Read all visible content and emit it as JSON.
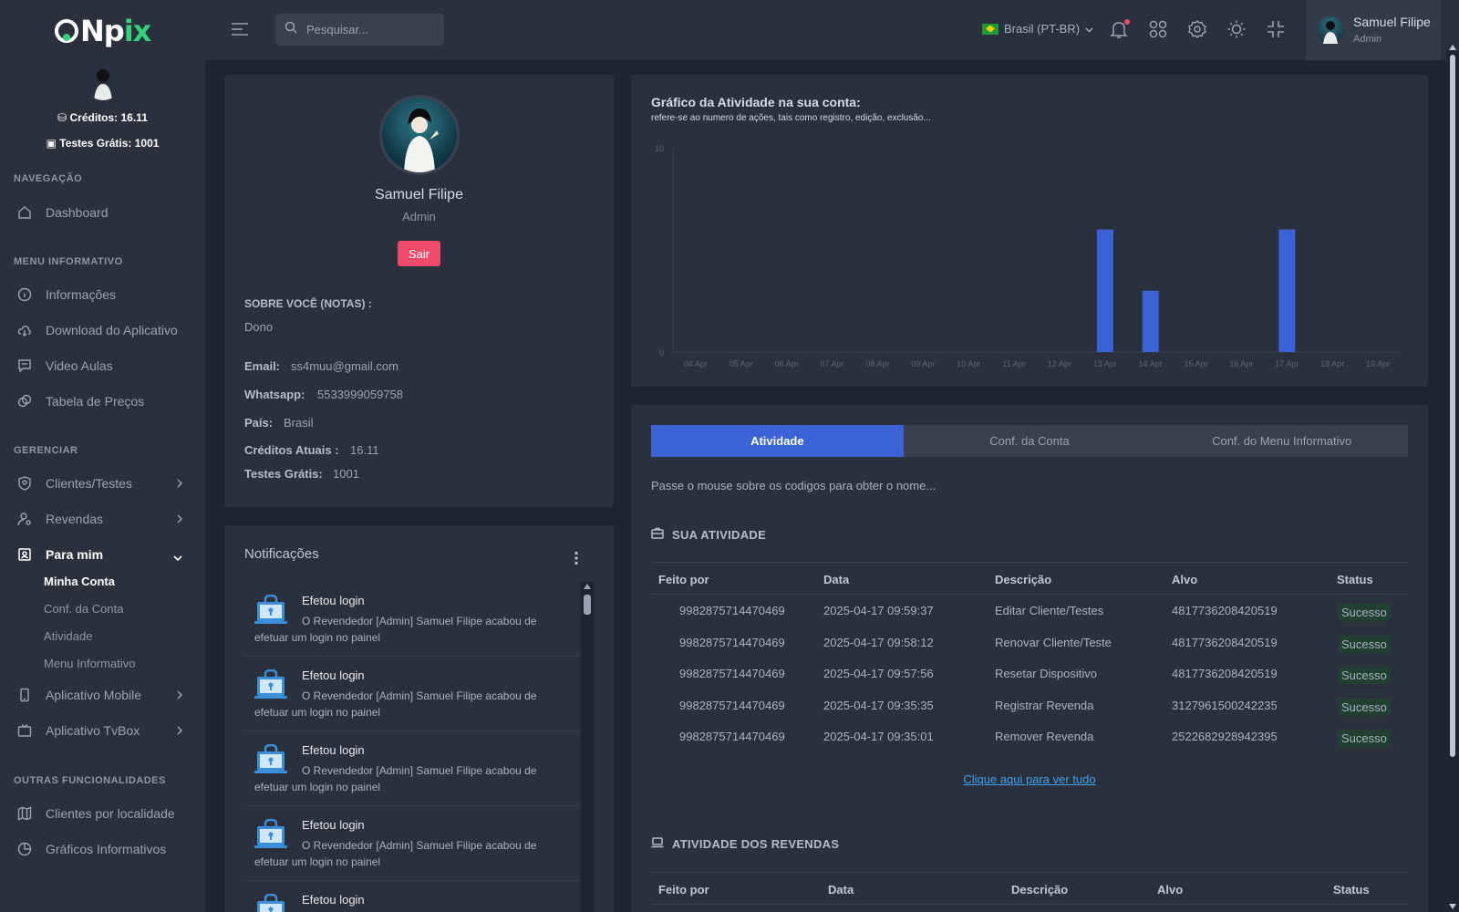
{
  "brand": {
    "logo_text": "Npix",
    "logo_accent": "x"
  },
  "sidebar": {
    "credits": "Créditos: 16.11",
    "free_tests": "Testes Grátis: 1001",
    "sections": {
      "nav": "NAVEGAÇÃO",
      "info": "MENU INFORMATIVO",
      "manage": "GERENCIAR",
      "others": "OUTRAS FUNCIONALIDADES"
    },
    "items": {
      "dashboard": "Dashboard",
      "informacoes": "Informações",
      "download": "Download do Aplicativo",
      "video": "Video Aulas",
      "precos": "Tabela de Preços",
      "clientes": "Clientes/Testes",
      "revendas": "Revendas",
      "para_mim": "Para mim",
      "app_mobile": "Aplicativo Mobile",
      "app_tvbox": "Aplicativo TvBox",
      "localidade": "Clientes por localidade",
      "graficos": "Gráficos Informativos"
    },
    "sub_items": [
      "Minha Conta",
      "Conf. da Conta",
      "Atividade",
      "Menu Informativo"
    ]
  },
  "topbar": {
    "search_placeholder": "Pesquisar...",
    "language": "Brasil (PT-BR)",
    "user_name": "Samuel Filipe",
    "user_role": "Admin"
  },
  "profile": {
    "name": "Samuel Filipe",
    "role": "Admin",
    "logout": "Sair",
    "about_label": "SOBRE VOCÊ (NOTAS) :",
    "about_value": "Dono",
    "email_label": "Email:",
    "email": "ss4muu@gmail.com",
    "whatsapp_label": "Whatsapp:",
    "whatsapp": "5533999059758",
    "country_label": "País:",
    "country": "Brasil",
    "credits_label": "Créditos Atuais :",
    "credits": "16.11",
    "tests_label": "Testes Grátis:",
    "tests": "1001"
  },
  "notifications": {
    "title": "Notificações",
    "items": [
      {
        "title": "Efetou login",
        "desc": "O Revendedor [Admin] Samuel Filipe acabou de efetuar um login no painel"
      },
      {
        "title": "Efetou login",
        "desc": "O Revendedor [Admin] Samuel Filipe acabou de efetuar um login no painel"
      },
      {
        "title": "Efetou login",
        "desc": "O Revendedor [Admin] Samuel Filipe acabou de efetuar um login no painel"
      },
      {
        "title": "Efetou login",
        "desc": "O Revendedor [Admin] Samuel Filipe acabou de efetuar um login no painel"
      },
      {
        "title": "Efetou login",
        "desc": ""
      }
    ]
  },
  "chart_data": {
    "type": "bar",
    "title": "Gráfico da Atividade na sua conta:",
    "subtitle": "refere-se ao numero de ações, tais como registro, edição, exclusão...",
    "categories": [
      "04 Apr",
      "05 Apr",
      "06 Apr",
      "07 Apr",
      "08 Apr",
      "09 Apr",
      "10 Apr",
      "11 Apr",
      "12 Apr",
      "13 Apr",
      "14 Apr",
      "15 Apr",
      "16 Apr",
      "17 Apr",
      "18 Apr",
      "19 Apr"
    ],
    "values": [
      0,
      0,
      0,
      0,
      0,
      0,
      0,
      0,
      0,
      6,
      3,
      0,
      0,
      6,
      0,
      0
    ],
    "ylim": [
      0,
      10
    ],
    "yticks": [
      "0",
      "10"
    ],
    "color": "#3b63d6"
  },
  "tabs": {
    "items": [
      "Atividade",
      "Conf. da Conta",
      "Conf. do Menu Informativo"
    ],
    "hint": "Passe o mouse sobre os codigos para obter o nome...",
    "your_activity": "SUA ATIVIDADE",
    "resellers_activity": "ATIVIDADE DOS REVENDAS",
    "columns": [
      "Feito por",
      "Data",
      "Descrição",
      "Alvo",
      "Status"
    ],
    "rows": [
      {
        "by": "9982875714470469",
        "date": "2025-04-17 09:59:37",
        "desc": "Editar Cliente/Testes",
        "target": "4817736208420519",
        "status": "Sucesso"
      },
      {
        "by": "9982875714470469",
        "date": "2025-04-17 09:58:12",
        "desc": "Renovar Cliente/Teste",
        "target": "4817736208420519",
        "status": "Sucesso"
      },
      {
        "by": "9982875714470469",
        "date": "2025-04-17 09:57:56",
        "desc": "Resetar Dispositivo",
        "target": "4817736208420519",
        "status": "Sucesso"
      },
      {
        "by": "9982875714470469",
        "date": "2025-04-17 09:35:35",
        "desc": "Registrar Revenda",
        "target": "3127961500242235",
        "status": "Sucesso"
      },
      {
        "by": "9982875714470469",
        "date": "2025-04-17 09:35:01",
        "desc": "Remover Revenda",
        "target": "2522682928942395",
        "status": "Sucesso"
      }
    ],
    "see_all": "Clique aqui para ver tudo"
  },
  "colors": {
    "accent": "#3b63d6",
    "danger": "#ef4a6a",
    "success": "#3bc46a",
    "bg": "#1f2530",
    "card": "#2b313c"
  }
}
